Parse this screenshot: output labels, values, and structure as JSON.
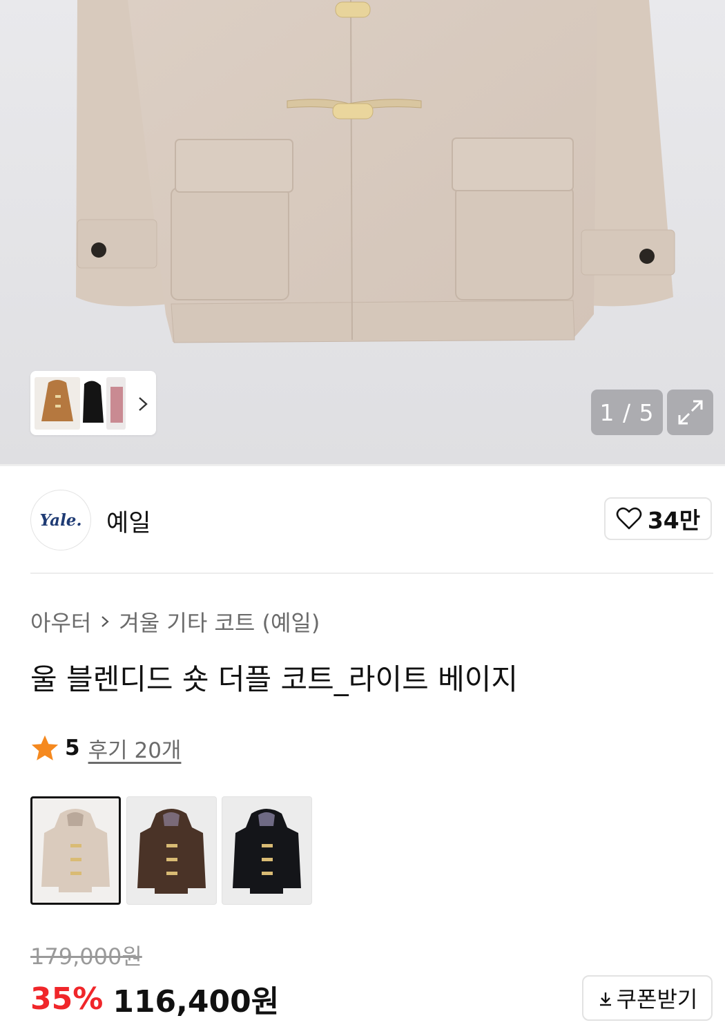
{
  "gallery": {
    "counter": "1 / 5"
  },
  "brand": {
    "logo_text": "Yale.",
    "name": "예일",
    "likes": "34만"
  },
  "breadcrumb": [
    "아우터",
    "겨울 기타 코트 (예일)"
  ],
  "product": {
    "title": "울 블렌디드 숏 더플 코트_라이트 베이지",
    "rating": "5",
    "reviews": "후기 20개"
  },
  "color_options": [
    "light-beige",
    "brown",
    "black"
  ],
  "price": {
    "original": "179,000원",
    "discount": "35%",
    "final": "116,400원"
  },
  "coupon": {
    "label": "쿠폰받기"
  },
  "colors": {
    "discount_red": "#f0262a",
    "star": "#f5891f",
    "coat_beige": "#d9cbbf"
  }
}
